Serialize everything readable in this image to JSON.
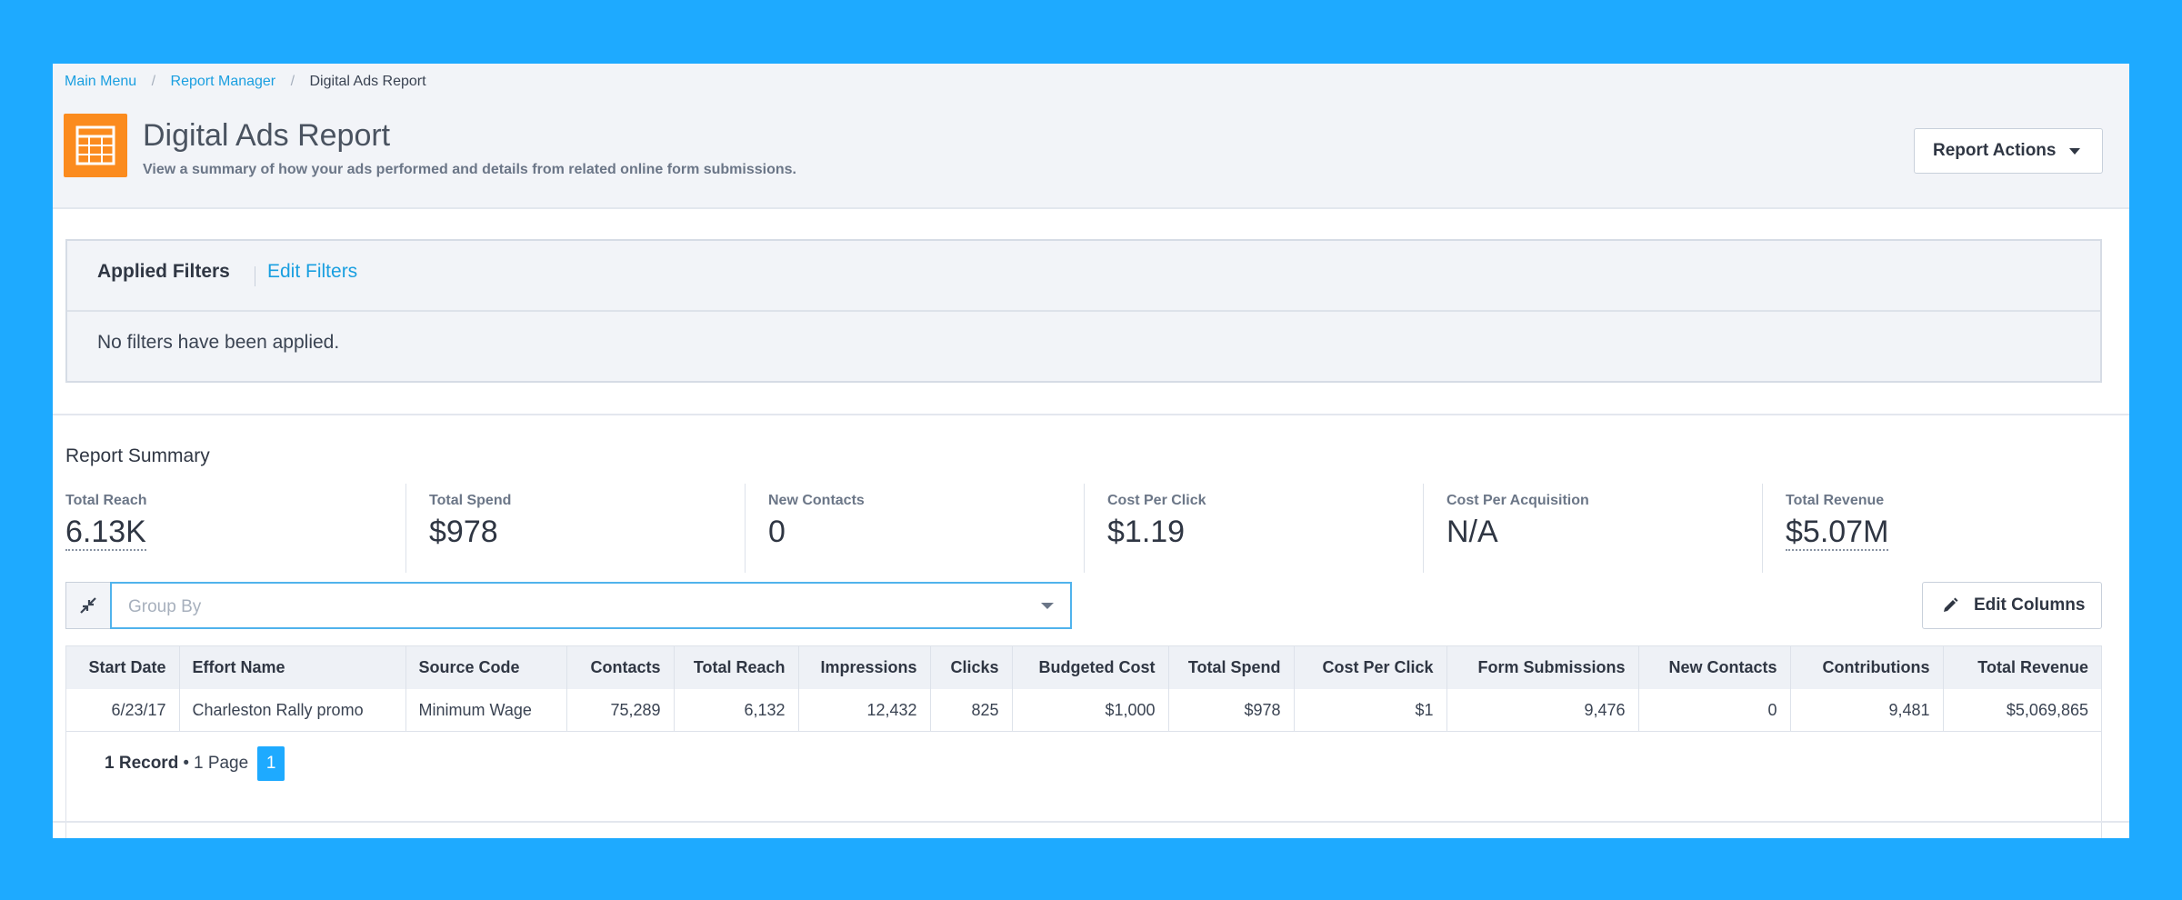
{
  "breadcrumb": {
    "items": [
      "Main Menu",
      "Report Manager"
    ],
    "current": "Digital Ads Report"
  },
  "header": {
    "title": "Digital Ads Report",
    "subtitle": "View a summary of how your ads performed and details from related online form submissions.",
    "icon": "spreadsheet-icon",
    "report_actions_label": "Report Actions"
  },
  "filters": {
    "heading": "Applied Filters",
    "edit_label": "Edit Filters",
    "empty_text": "No filters have been applied."
  },
  "summary": {
    "title": "Report Summary",
    "metrics": [
      {
        "label": "Total Reach",
        "value": "6.13K"
      },
      {
        "label": "Total Spend",
        "value": "$978"
      },
      {
        "label": "New Contacts",
        "value": "0"
      },
      {
        "label": "Cost Per Click",
        "value": "$1.19"
      },
      {
        "label": "Cost Per Acquisition",
        "value": "N/A"
      },
      {
        "label": "Total Revenue",
        "value": "$5.07M"
      }
    ]
  },
  "controls": {
    "group_by_placeholder": "Group By",
    "edit_columns_label": "Edit Columns"
  },
  "table": {
    "columns": [
      "Start Date",
      "Effort Name",
      "Source Code",
      "Contacts",
      "Total Reach",
      "Impressions",
      "Clicks",
      "Budgeted Cost",
      "Total Spend",
      "Cost Per Click",
      "Form Submissions",
      "New Contacts",
      "Contributions",
      "Total Revenue"
    ],
    "rows": [
      [
        "6/23/17",
        "Charleston Rally promo",
        "Minimum Wage",
        "75,289",
        "6,132",
        "12,432",
        "825",
        "$1,000",
        "$978",
        "$1",
        "9,476",
        "0",
        "9,481",
        "$5,069,865"
      ]
    ]
  },
  "pager": {
    "records": "1 Record",
    "separator": "•",
    "pages": "1 Page",
    "current_page": "1"
  },
  "colors": {
    "background": "#1eaaff",
    "accent": "#1a9fe0",
    "icon_bg": "#fb8b1e"
  }
}
